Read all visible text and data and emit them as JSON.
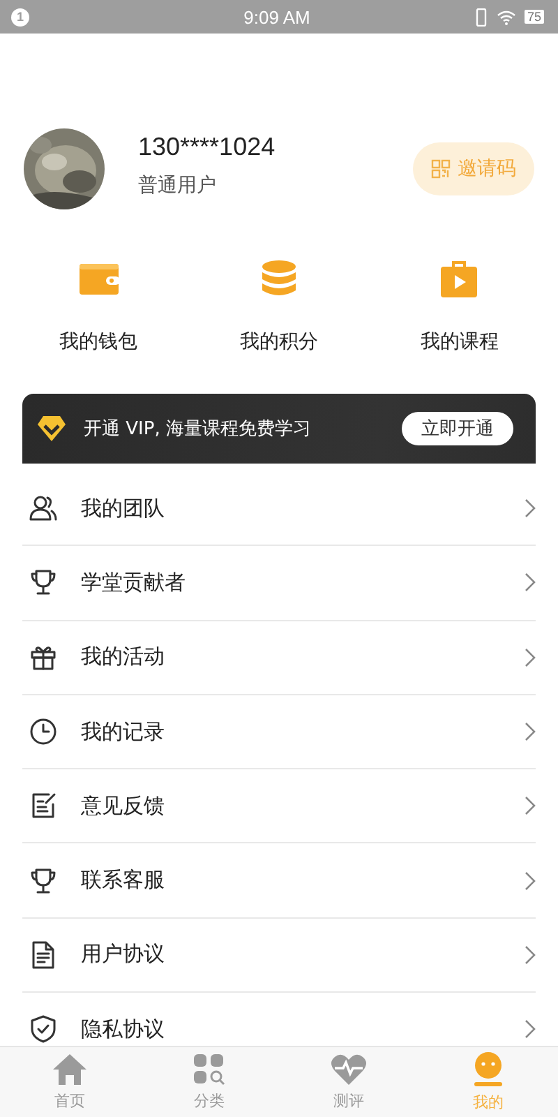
{
  "status_bar": {
    "notification_count": "1",
    "time": "9:09 AM",
    "battery": "75"
  },
  "profile": {
    "phone": "130****1024",
    "role": "普通用户",
    "invite_button": "邀请码"
  },
  "shortcuts": [
    {
      "kind": "wallet",
      "label": "我的钱包"
    },
    {
      "kind": "points",
      "label": "我的积分"
    },
    {
      "kind": "course",
      "label": "我的课程"
    }
  ],
  "vip_banner": {
    "text": "开通 VIP, 海量课程免费学习",
    "button": "立即开通"
  },
  "menu": [
    {
      "kind": "team",
      "label": "我的团队"
    },
    {
      "kind": "trophy",
      "label": "学堂贡献者"
    },
    {
      "kind": "gift",
      "label": "我的活动"
    },
    {
      "kind": "clock",
      "label": "我的记录"
    },
    {
      "kind": "feedback",
      "label": "意见反馈"
    },
    {
      "kind": "trophy",
      "label": "联系客服"
    },
    {
      "kind": "document",
      "label": "用户协议"
    },
    {
      "kind": "shield",
      "label": "隐私协议"
    }
  ],
  "tab_bar": [
    {
      "kind": "home",
      "label": "首页",
      "selected": false
    },
    {
      "kind": "category",
      "label": "分类",
      "selected": false
    },
    {
      "kind": "heart",
      "label": "测评",
      "selected": false
    },
    {
      "kind": "me",
      "label": "我的",
      "selected": true
    }
  ]
}
